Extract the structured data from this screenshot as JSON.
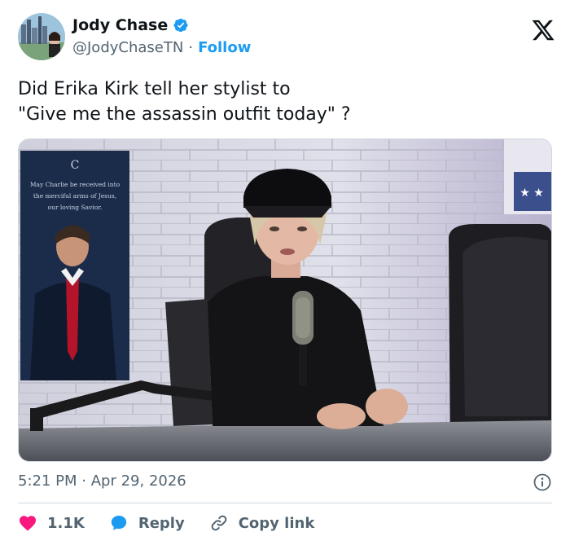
{
  "author": {
    "display_name": "Jody Chase",
    "handle": "@JodyChaseTN",
    "separator": "·",
    "follow_label": "Follow",
    "verified_color": "#1d9bf0"
  },
  "tweet": {
    "text": "Did Erika Kirk tell her stylist to\n\"Give me the assassin outfit today\" ?"
  },
  "media": {
    "poster_text_lines": [
      "May Charlie be received into",
      "the merciful arms of Jesus,",
      "our loving Savior."
    ]
  },
  "meta": {
    "time": "5:21 PM",
    "separator": "·",
    "date": "Apr 29, 2026"
  },
  "actions": {
    "likes": "1.1K",
    "reply_label": "Reply",
    "copy_link_label": "Copy link"
  },
  "colors": {
    "text": "#0f1419",
    "muted": "#536471",
    "accent": "#1d9bf0",
    "heart": "#f91880",
    "divider": "#cfd9de"
  },
  "icons": [
    "x-logo-icon",
    "verified-badge-icon",
    "info-icon",
    "heart-icon",
    "reply-bubble-icon",
    "link-icon"
  ]
}
